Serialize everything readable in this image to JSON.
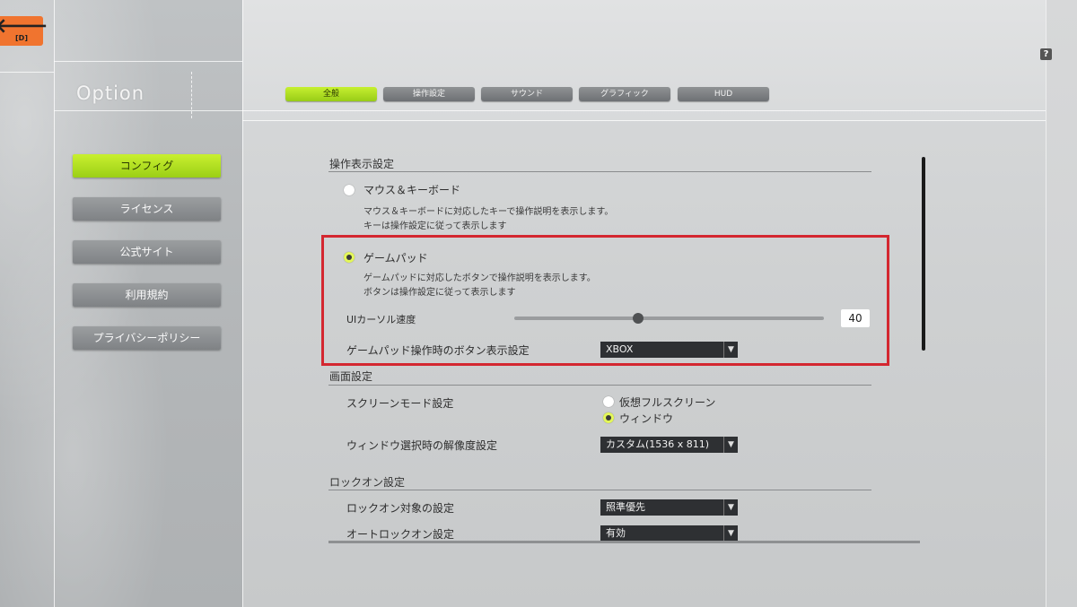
{
  "header": {
    "back_key": "[D]",
    "title": "Option",
    "help": "?"
  },
  "tabs": [
    {
      "label": "全般",
      "active": true
    },
    {
      "label": "操作設定",
      "active": false
    },
    {
      "label": "サウンド",
      "active": false
    },
    {
      "label": "グラフィック",
      "active": false
    },
    {
      "label": "HUD",
      "active": false
    }
  ],
  "sidebar": {
    "items": [
      {
        "label": "コンフィグ",
        "active": true
      },
      {
        "label": "ライセンス",
        "active": false
      },
      {
        "label": "公式サイト",
        "active": false
      },
      {
        "label": "利用規約",
        "active": false
      },
      {
        "label": "プライバシーポリシー",
        "active": false
      }
    ]
  },
  "controls_display": {
    "title": "操作表示設定",
    "mouse_keyboard": {
      "label": "マウス＆キーボード",
      "desc1": "マウス＆キーボードに対応したキーで操作説明を表示します。",
      "desc2": "キーは操作設定に従って表示します",
      "selected": false
    },
    "gamepad": {
      "label": "ゲームパッド",
      "desc1": "ゲームパッドに対応したボタンで操作説明を表示します。",
      "desc2": "ボタンは操作設定に従って表示します",
      "selected": true
    },
    "cursor_speed": {
      "label": "UIカーソル速度",
      "value": "40",
      "fraction": 0.4
    },
    "button_display": {
      "label": "ゲームパッド操作時のボタン表示設定",
      "value": "XBOX"
    }
  },
  "screen": {
    "title": "画面設定",
    "mode_label": "スクリーンモード設定",
    "mode_options": [
      {
        "label": "仮想フルスクリーン",
        "selected": false
      },
      {
        "label": "ウィンドウ",
        "selected": true
      }
    ],
    "resolution_label": "ウィンドウ選択時の解像度設定",
    "resolution_value": "カスタム(1536 x 811)"
  },
  "lockon": {
    "title": "ロックオン設定",
    "target_label": "ロックオン対象の設定",
    "target_value": "照準優先",
    "auto_label": "オートロックオン設定",
    "auto_value": "有効"
  },
  "colors": {
    "accent": "#b5e024",
    "highlight": "#d42730",
    "back_button": "#f0742f"
  }
}
